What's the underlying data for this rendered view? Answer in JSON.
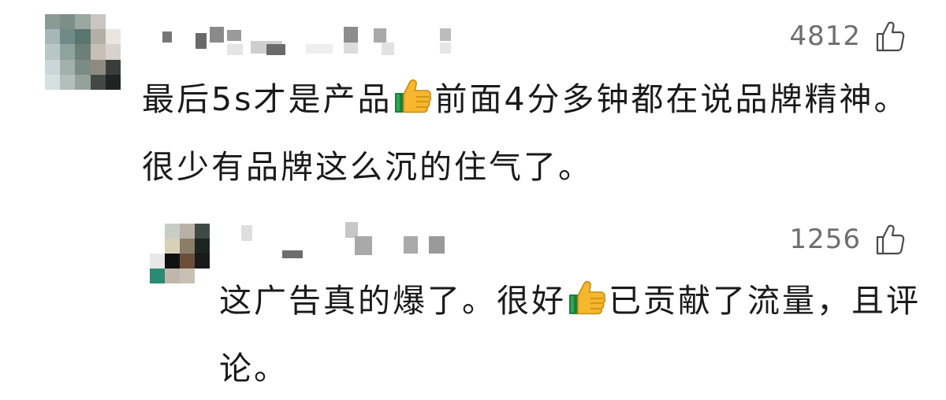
{
  "comments": [
    {
      "likes": "4812",
      "text_before": "最后5s才是产品",
      "emoji": "thumbs-up",
      "text_after": "前面4分多钟都在说品牌精神。很少有品牌这么沉的住气了。"
    },
    {
      "likes": "1256",
      "text_before": "这广告真的爆了。很好",
      "emoji": "thumbs-up",
      "text_after": "已贡献了流量，且评论。"
    }
  ],
  "icons": {
    "like": "thumbs-up-outline-icon",
    "emoji": "thumbs-up-emoji"
  },
  "colors": {
    "text": "#1a1a1a",
    "like_count": "#6e6e6e",
    "background": "#ffffff"
  }
}
